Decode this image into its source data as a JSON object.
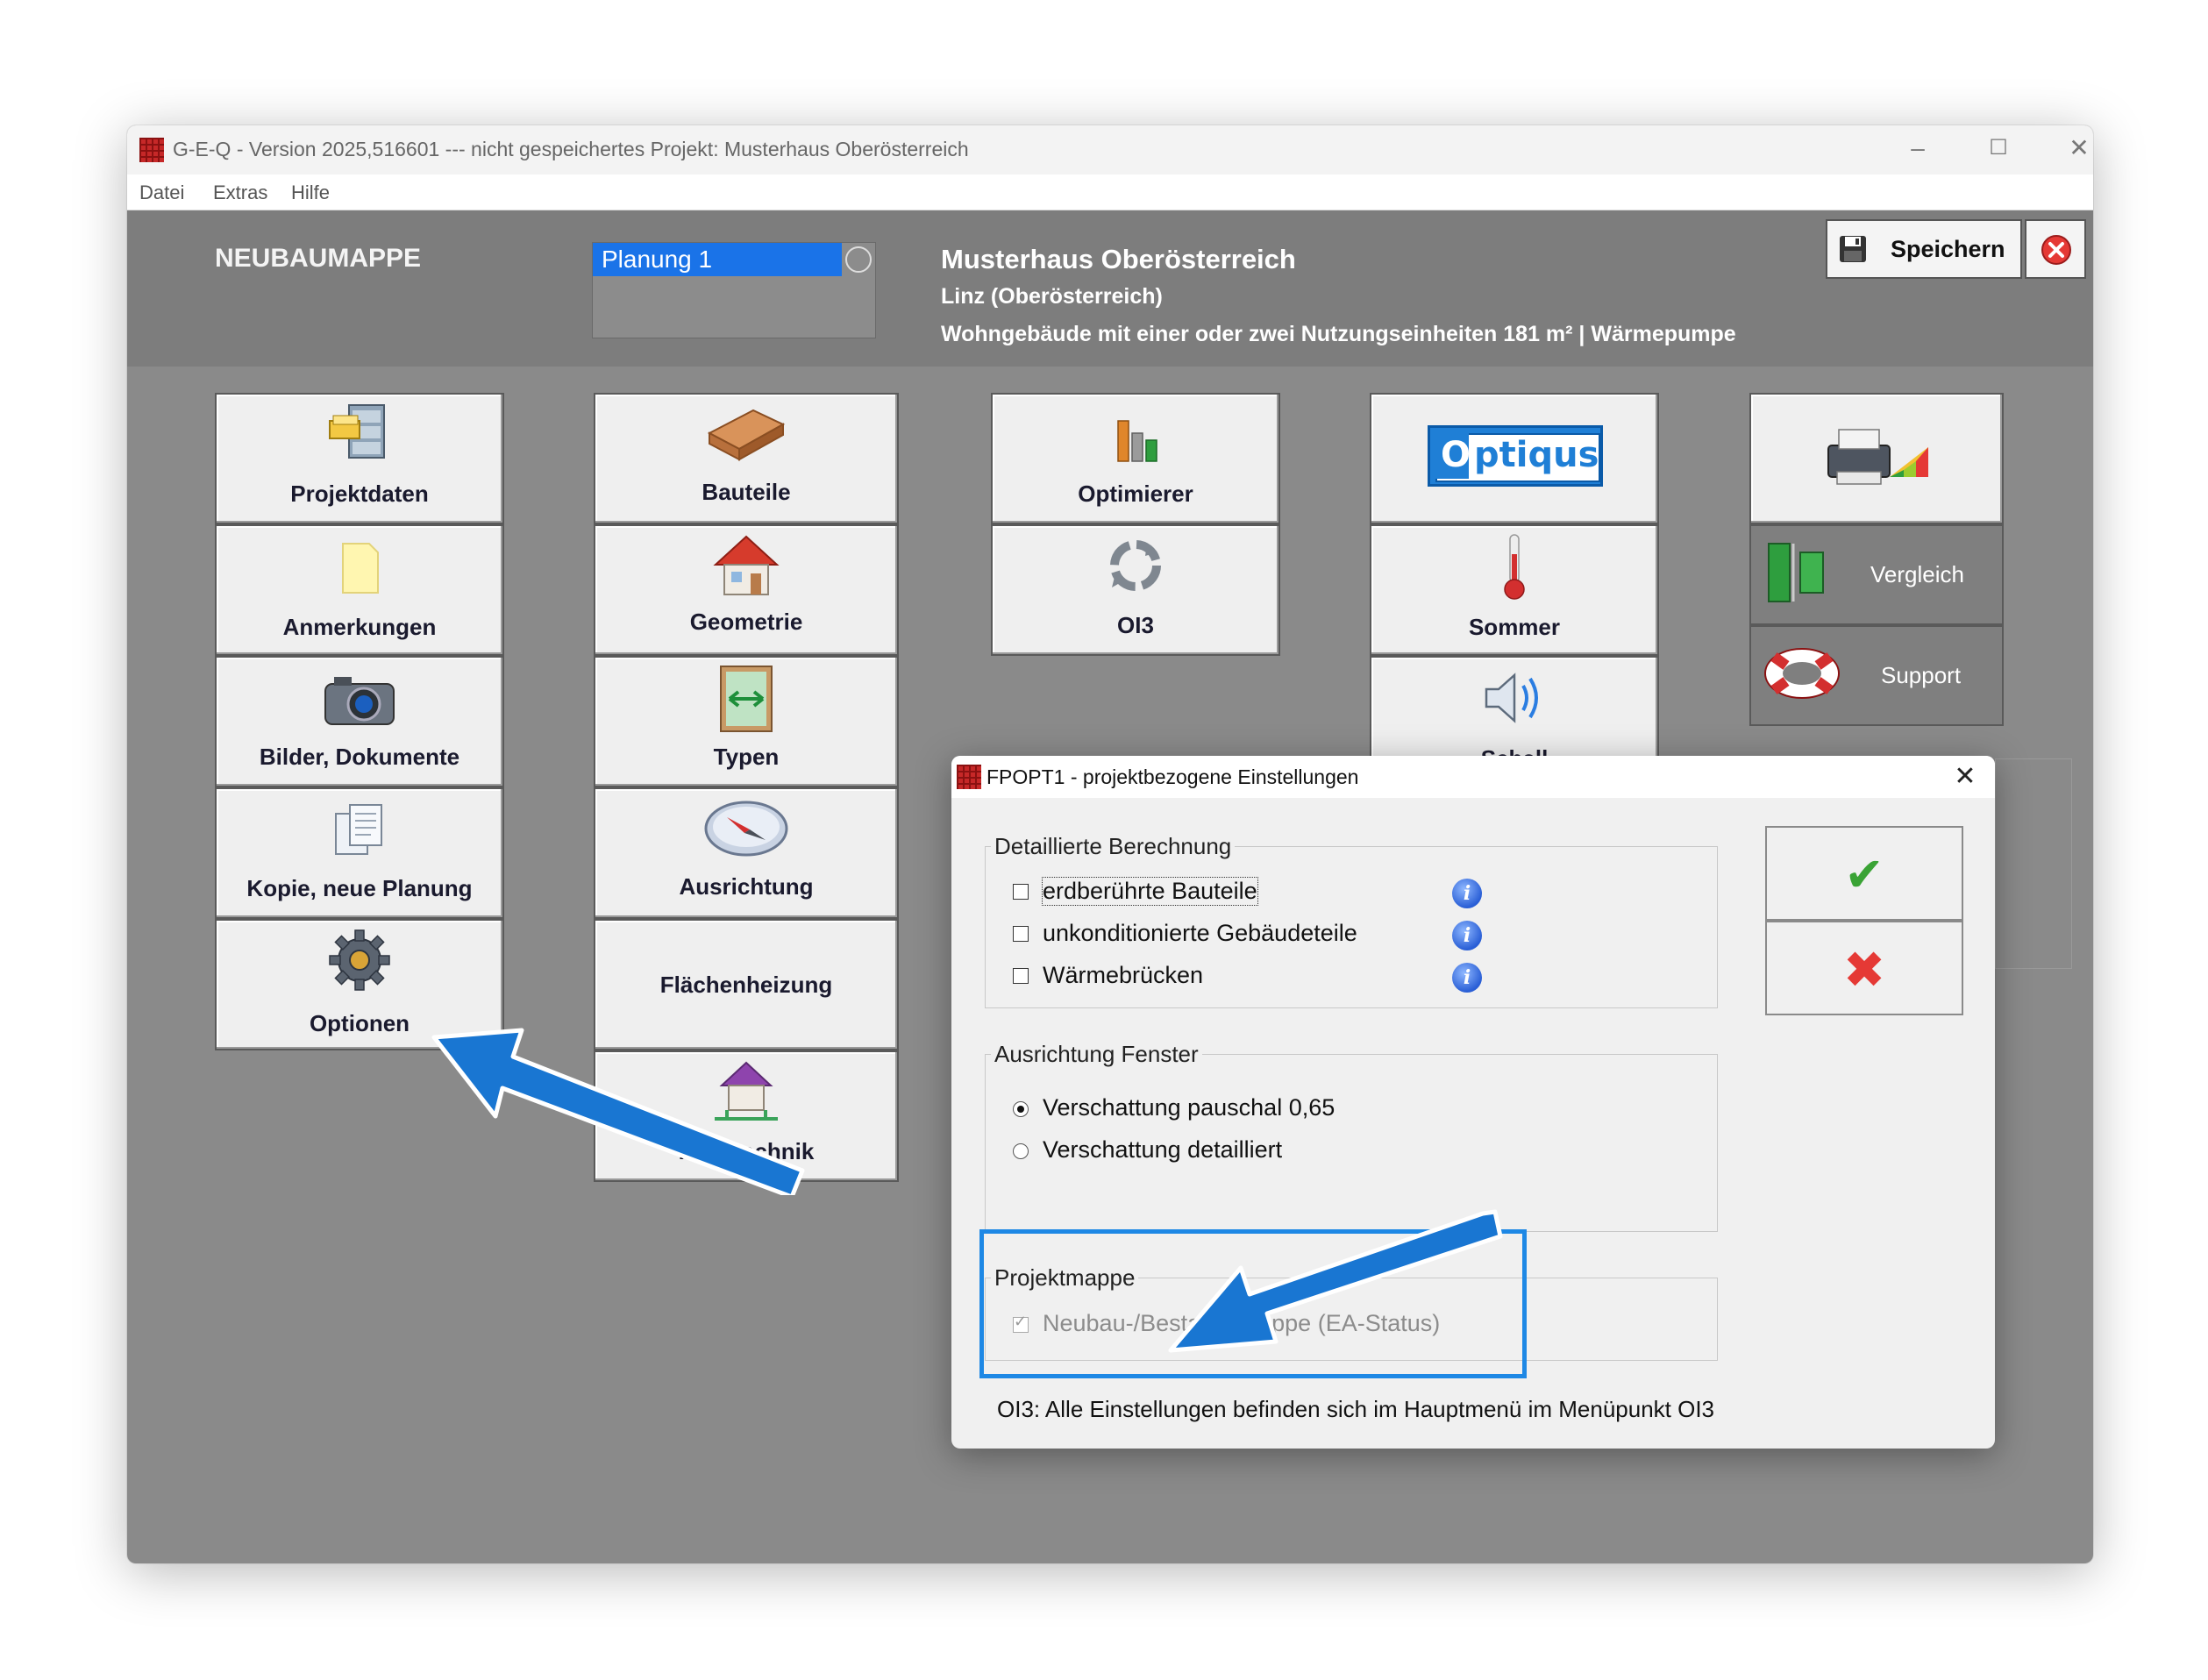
{
  "window": {
    "title": "G-E-Q - Version 2025,516601  ---  nicht gespeichertes Projekt: Musterhaus Oberösterreich",
    "controls": {
      "minimize": "–",
      "maximize": "☐",
      "close": "✕"
    }
  },
  "menu": [
    "Datei",
    "Extras",
    "Hilfe"
  ],
  "header": {
    "section": "NEUBAUMAPPE",
    "planning_selected": "Planung 1",
    "project_name": "Musterhaus Oberösterreich",
    "location": "Linz (Oberösterreich)",
    "building_info": "Wohngebäude mit einer oder zwei Nutzungseinheiten  181 m²  |  Wärmepumpe",
    "save_label": "Speichern"
  },
  "tiles": {
    "projektdaten": "Projektdaten",
    "anmerkungen": "Anmerkungen",
    "bilder": "Bilder, Dokumente",
    "kopie": "Kopie, neue Planung",
    "optionen": "Optionen",
    "bauteile": "Bauteile",
    "geometrie": "Geometrie",
    "typen": "Typen",
    "ausrichtung": "Ausrichtung",
    "flaechenheizung": "Flächenheizung",
    "haustechnik": "Haustechnik",
    "optimierer": "Optimierer",
    "oi3": "OI3",
    "optiqus_logo": "Optiqus",
    "sommer": "Sommer",
    "schall": "Schall",
    "vergleich": "Vergleich",
    "support": "Support"
  },
  "dialog": {
    "title": "FPOPT1 - projektbezogene Einstellungen",
    "group1": {
      "legend": "Detaillierte Berechnung",
      "options": [
        {
          "label": "erdberührte Bauteile",
          "checked": false
        },
        {
          "label": "unkonditionierte Gebäudeteile",
          "checked": false
        },
        {
          "label": "Wärmebrücken",
          "checked": false
        }
      ]
    },
    "group2": {
      "legend": "Ausrichtung Fenster",
      "options": [
        {
          "label": "Verschattung pauschal 0,65",
          "selected": true
        },
        {
          "label": "Verschattung detailliert",
          "selected": false
        }
      ]
    },
    "group3": {
      "legend": "Projektmappe",
      "options": [
        {
          "label": "Neubau-/Bestandsmappe (EA-Status)",
          "checked": true,
          "disabled": true
        }
      ]
    },
    "footer_note": "OI3: Alle Einstellungen befinden sich im Hauptmenü im Menüpunkt OI3",
    "ok_symbol": "✔",
    "cancel_symbol": "✖"
  },
  "colors": {
    "highlight_blue": "#1e88e5",
    "arrow_blue": "#1976d2",
    "selection_blue": "#1a73e8",
    "window_gray": "#8a8a8a"
  }
}
